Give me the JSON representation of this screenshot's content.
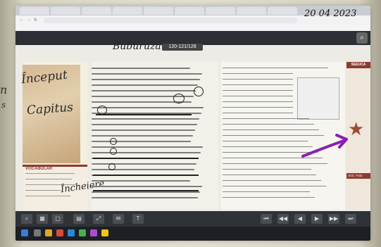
{
  "browser": {
    "tabs": [
      "",
      "",
      "",
      "",
      "",
      "",
      "",
      "",
      "",
      ""
    ],
    "url": ""
  },
  "book": {
    "title": "Buburuza",
    "page_indicator": "120-121/128"
  },
  "left_page": {
    "handwritten_title_line1": "Început",
    "handwritten_title_line2": "Capitus",
    "vocabulary_heading": "VOCABULAR",
    "handwritten_note": "Încheiere"
  },
  "right_panel": {
    "sidebar_heading": "SEEUCA",
    "game_heading": "JOC: Foto"
  },
  "handwriting": {
    "date": "20 04 2023"
  },
  "colors": {
    "accent": "#8d3b2f",
    "arrow": "#8a1fb0"
  }
}
